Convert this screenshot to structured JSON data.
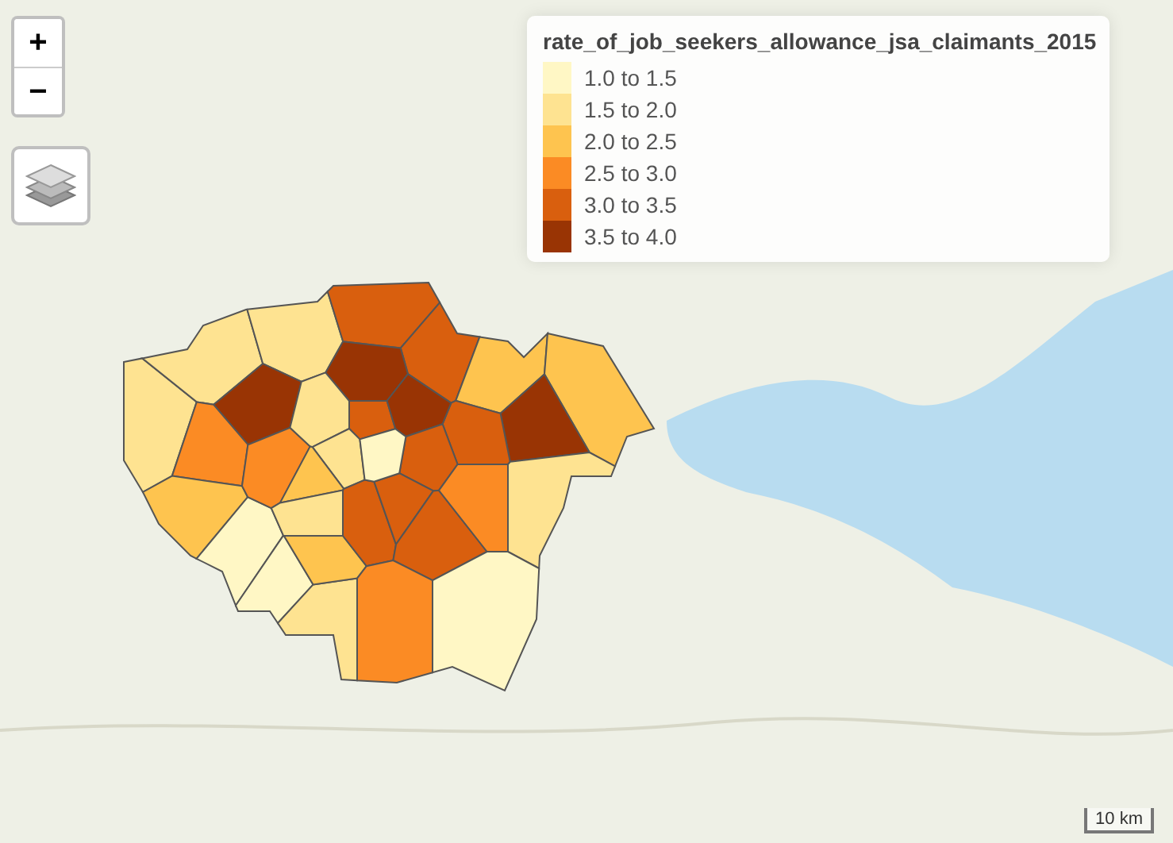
{
  "zoom_control": {
    "zoom_in": "+",
    "zoom_out": "−"
  },
  "legend": {
    "title": "rate_of_job_seekers_allowance_jsa_claimants_2015",
    "items": [
      {
        "label": "1.0 to 1.5",
        "color": "#fff7c5"
      },
      {
        "label": "1.5 to 2.0",
        "color": "#fee391"
      },
      {
        "label": "2.0 to 2.5",
        "color": "#fec44f"
      },
      {
        "label": "2.5 to 3.0",
        "color": "#fb8b24"
      },
      {
        "label": "3.0 to 3.5",
        "color": "#d95f0e"
      },
      {
        "label": "3.5 to 4.0",
        "color": "#993404"
      }
    ]
  },
  "boroughs": [
    {
      "color": "#fee391"
    },
    {
      "color": "#fee391"
    },
    {
      "color": "#fee391"
    },
    {
      "color": "#d95f0e"
    },
    {
      "color": "#d95f0e"
    },
    {
      "color": "#fec44f"
    },
    {
      "color": "#fec44f"
    },
    {
      "color": "#993404"
    },
    {
      "color": "#d95f0e"
    },
    {
      "color": "#993404"
    },
    {
      "color": "#993404"
    },
    {
      "color": "#fb8b24"
    },
    {
      "color": "#fec44f"
    },
    {
      "color": "#fff7c5"
    },
    {
      "color": "#fff7c5"
    },
    {
      "color": "#fee391"
    },
    {
      "color": "#fb8b24"
    },
    {
      "color": "#fee391"
    },
    {
      "color": "#d95f0e"
    },
    {
      "color": "#993404"
    },
    {
      "color": "#d95f0e"
    },
    {
      "color": "#fee391"
    },
    {
      "color": "#fec44f"
    },
    {
      "color": "#fee391"
    },
    {
      "color": "#fec44f"
    },
    {
      "color": "#d95f0e"
    },
    {
      "color": "#d95f0e"
    },
    {
      "color": "#d95f0e"
    },
    {
      "color": "#fb8b24"
    },
    {
      "color": "#fee391"
    },
    {
      "color": "#fff7c5"
    },
    {
      "color": "#fb8b24"
    },
    {
      "color": "#fff7c5"
    }
  ],
  "scale_bar": "10 km"
}
